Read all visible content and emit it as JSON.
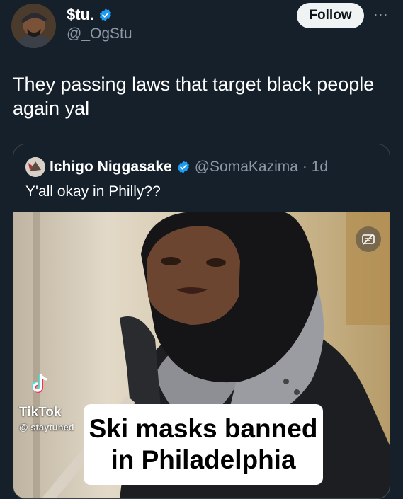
{
  "tweet": {
    "author_name": "$tu.",
    "author_handle": "@_OgStu",
    "follow_label": "Follow",
    "more_label": "···",
    "text": "They passing laws that target black people again yal"
  },
  "quote": {
    "author_name": "Ichigo Niggasake",
    "author_handle": "@SomaKazima",
    "time": "· 1d",
    "text": "Y'all okay in Philly??",
    "media": {
      "watermark": "TikTok",
      "watermark_user": "@ staytuned",
      "caption_line1": "Ski masks banned",
      "caption_line2": "in Philadelphia"
    }
  },
  "colors": {
    "background": "#15202b",
    "verified": "#1d9bf0",
    "secondary_text": "#8b98a5",
    "border": "#38444d"
  },
  "icons": {
    "verified": "verified-badge-icon",
    "more": "more-options-icon",
    "media_control": "caption-toggle-icon",
    "tiktok": "tiktok-logo-icon"
  }
}
